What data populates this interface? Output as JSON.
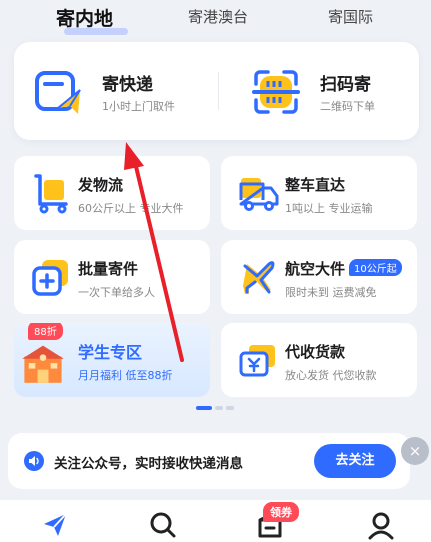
{
  "tabs": [
    {
      "label": "寄内地",
      "active": true
    },
    {
      "label": "寄港澳台",
      "active": false
    },
    {
      "label": "寄国际",
      "active": false
    }
  ],
  "hero": [
    {
      "title": "寄快递",
      "subtitle": "1小时上门取件",
      "icon": "send-box-icon"
    },
    {
      "title": "扫码寄",
      "subtitle": "二维码下单",
      "icon": "scan-qr-icon"
    }
  ],
  "services": [
    {
      "title": "发物流",
      "subtitle": "60公斤以上 专业大件",
      "icon": "cart-box-icon"
    },
    {
      "title": "整车直达",
      "subtitle": "1吨以上 专业运输",
      "icon": "truck-icon"
    },
    {
      "title": "批量寄件",
      "subtitle": "一次下单给多人",
      "icon": "batch-plus-icon"
    },
    {
      "title": "航空大件",
      "subtitle": "限时未到 运费减免",
      "tag": "10公斤起",
      "icon": "airplane-icon"
    },
    {
      "title": "学生专区",
      "subtitle": "月月福利  低至88折",
      "badge": "88折",
      "icon": "school-icon"
    },
    {
      "title": "代收货款",
      "subtitle": "放心发货 代您收款",
      "icon": "yuan-card-icon"
    }
  ],
  "notice": {
    "text": "关注公众号，实时接收快递消息",
    "button": "去关注",
    "close": "×"
  },
  "nav": {
    "coupon": "领券"
  },
  "colors": {
    "accent": "#2f6bff",
    "yellow": "#ffc21a",
    "red": "#ff4a57",
    "arrow": "#e8202a"
  }
}
